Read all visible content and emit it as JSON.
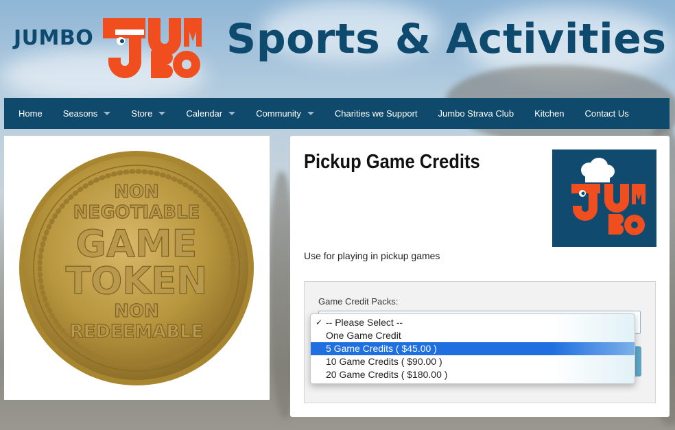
{
  "site": {
    "logo_text": "JUMBO",
    "logo_mark_text": "JUMBO",
    "title": "Sports & Activities"
  },
  "nav": {
    "items": [
      {
        "label": "Home",
        "has_menu": false
      },
      {
        "label": "Seasons",
        "has_menu": true
      },
      {
        "label": "Store",
        "has_menu": true
      },
      {
        "label": "Calendar",
        "has_menu": true
      },
      {
        "label": "Community",
        "has_menu": true
      },
      {
        "label": "Charities we Support",
        "has_menu": false
      },
      {
        "label": "Jumbo Strava Club",
        "has_menu": false
      },
      {
        "label": "Kitchen",
        "has_menu": false
      },
      {
        "label": "Contact Us",
        "has_menu": false
      }
    ]
  },
  "token": {
    "lines": [
      "NON",
      "NEGOTIABLE",
      "GAME",
      "TOKEN",
      "NON",
      "REDEEMABLE"
    ]
  },
  "product": {
    "title": "Pickup Game Credits",
    "description": "Use for playing in pickup games",
    "thumb_text": "JUMBO"
  },
  "credit_packs": {
    "label": "Game Credit Packs:",
    "options": [
      {
        "label": "-- Please Select --",
        "checked": true,
        "highlighted": false
      },
      {
        "label": "One Game Credit",
        "checked": false,
        "highlighted": false
      },
      {
        "label": "5 Game Credits ( $45.00 )",
        "checked": false,
        "highlighted": true
      },
      {
        "label": "10 Game Credits ( $90.00 )",
        "checked": false,
        "highlighted": false
      },
      {
        "label": "20 Game Credits ( $180.00 )",
        "checked": false,
        "highlighted": false
      }
    ],
    "check_glyph": "✓"
  },
  "colors": {
    "brand_navy": "#0f4a6d",
    "brand_orange": "#f04e1e",
    "highlight_blue": "#1f6fe0"
  }
}
